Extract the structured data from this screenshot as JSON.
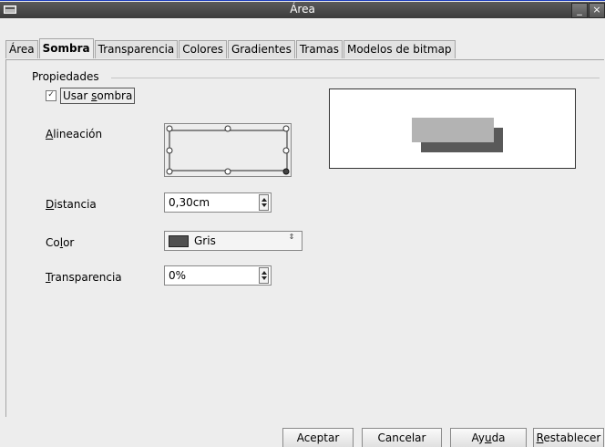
{
  "window": {
    "title": "Área",
    "minimize_glyph": "_",
    "close_glyph": "×",
    "title_icon": "window-menu-icon"
  },
  "tabs": [
    {
      "label": "Área",
      "active": false
    },
    {
      "label": "Sombra",
      "active": true
    },
    {
      "label": "Transparencia",
      "active": false
    },
    {
      "label": "Colores",
      "active": false
    },
    {
      "label": "Gradientes",
      "active": false
    },
    {
      "label": "Tramas",
      "active": false
    },
    {
      "label": "Modelos de bitmap",
      "active": false
    }
  ],
  "properties": {
    "section_title": "Propiedades",
    "use_shadow": {
      "checked": true,
      "check_glyph": "✓",
      "label_pre": "Usar ",
      "label_key": "s",
      "label_post": "ombra"
    },
    "alignment": {
      "label_key": "A",
      "label_rest": "lineación",
      "selected": "bottom-right"
    },
    "distance": {
      "label_key": "D",
      "label_rest": "istancia",
      "value": "0,30cm"
    },
    "color": {
      "label_pre": "Co",
      "label_key": "l",
      "label_post": "or",
      "value": "Gris",
      "swatch": "#505050",
      "arrows_glyph": "⇕"
    },
    "transparency": {
      "label_key": "T",
      "label_rest": "ransparencia",
      "value": "0%"
    }
  },
  "preview": {
    "object_color": "#b3b3b3",
    "shadow_color": "#595959"
  },
  "buttons": {
    "ok": "Aceptar",
    "cancel": "Cancelar",
    "help_pre": "Ay",
    "help_key": "u",
    "help_post": "da",
    "reset_key": "R",
    "reset_rest": "establecer"
  },
  "colors": {
    "titlebar": "#4a4a4a",
    "dialog_bg": "#ededed",
    "accent_border": "#1a3bbd"
  }
}
